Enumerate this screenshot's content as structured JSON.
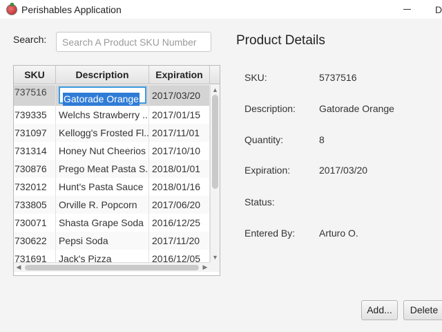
{
  "window": {
    "title": "Perishables Application",
    "minimize_symbol": "",
    "maximize_partial": "D"
  },
  "search": {
    "label": "Search:",
    "placeholder": "Search A Product SKU Number",
    "value": ""
  },
  "table": {
    "columns": [
      "SKU",
      "Description",
      "Expiration"
    ],
    "rows": [
      {
        "sku": "737516",
        "description": "Gatorade Orange",
        "expiration": "2017/03/20",
        "selected": true,
        "editing": true
      },
      {
        "sku": "739335",
        "description": "Welchs Strawberry ...",
        "expiration": "2017/01/15"
      },
      {
        "sku": "731097",
        "description": "Kellogg's Frosted Fl...",
        "expiration": "2017/11/01"
      },
      {
        "sku": "731314",
        "description": "Honey Nut Cheerios",
        "expiration": "2017/10/10"
      },
      {
        "sku": "730876",
        "description": "Prego Meat Pasta S...",
        "expiration": "2018/01/01"
      },
      {
        "sku": "732012",
        "description": "Hunt's Pasta Sauce",
        "expiration": "2018/01/16"
      },
      {
        "sku": "733805",
        "description": "Orville R. Popcorn",
        "expiration": "2017/06/20"
      },
      {
        "sku": "730071",
        "description": "Shasta Grape Soda",
        "expiration": "2016/12/25"
      },
      {
        "sku": "730622",
        "description": "Pepsi Soda",
        "expiration": "2017/11/20"
      },
      {
        "sku": "731691",
        "description": "Jack's Pizza",
        "expiration": "2016/12/05"
      }
    ]
  },
  "details": {
    "title": "Product Details",
    "sku_label": "SKU:",
    "sku_value": "5737516",
    "description_label": "Description:",
    "description_value": "Gatorade Orange",
    "quantity_label": "Quantity:",
    "quantity_value": "8",
    "expiration_label": "Expiration:",
    "expiration_value": "2017/03/20",
    "status_label": "Status:",
    "status_value": "",
    "entered_by_label": "Entered By:",
    "entered_by_value": "Arturo O."
  },
  "buttons": {
    "add_label": "Add...",
    "delete_label": "Delete"
  },
  "colors": {
    "selection_highlight": "#2f7cd6",
    "edit_border": "#3d9be0",
    "selected_row": "#d4d4d4"
  }
}
